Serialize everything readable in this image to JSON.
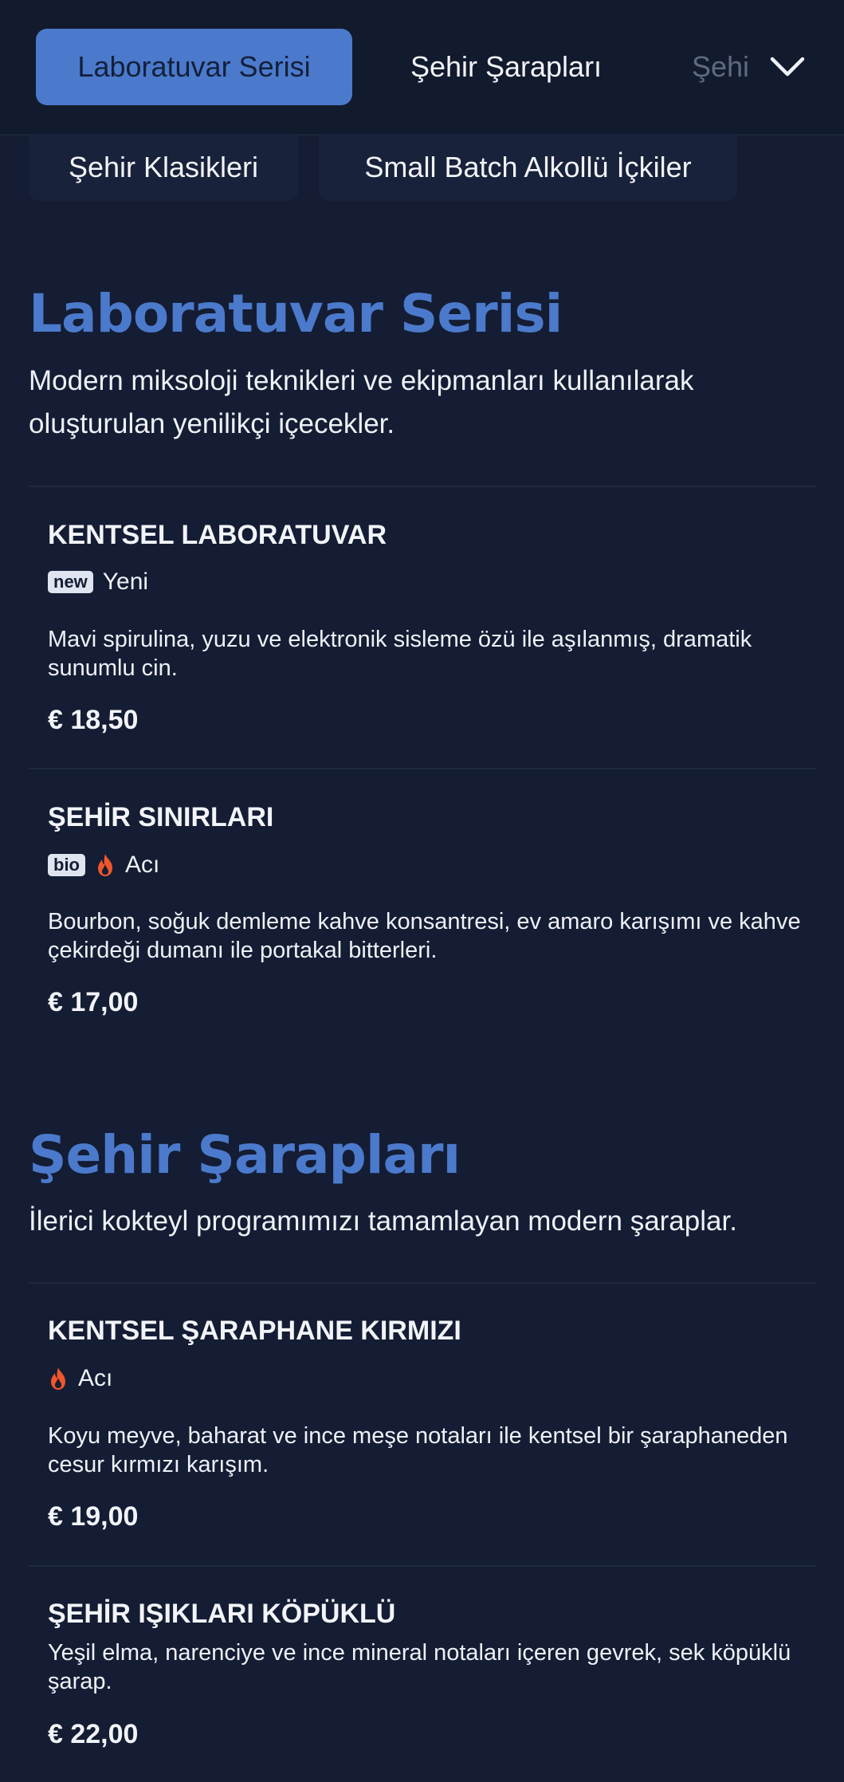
{
  "nav": {
    "tabs": [
      {
        "label": "Laboratuvar Serisi",
        "active": true
      },
      {
        "label": "Şehir Şarapları",
        "active": false
      },
      {
        "label": "Şehir",
        "active": false
      }
    ],
    "subtabs": [
      {
        "label": "Şehir Klasikleri"
      },
      {
        "label": "Small Batch Alkollü İçkiler"
      }
    ],
    "expand_icon": "chevron-down-icon"
  },
  "sections": [
    {
      "title": "Laboratuvar Serisi",
      "description": "Modern miksoloji teknikleri ve ekipmanları kullanılarak oluşturulan yenilikçi içecekler.",
      "items": [
        {
          "name": "KENTSEL LABORATUVAR",
          "badge": "new",
          "tag": "Yeni",
          "description": "Mavi spirulina, yuzu ve elektronik sisleme özü ile aşılanmış, dramatik sunumlu cin.",
          "price": "€ 18,50"
        },
        {
          "name": "ŞEHİR SINIRLARI",
          "badge": "bio",
          "tag": "Acı",
          "tag_icon": "flame-icon",
          "description": "Bourbon, soğuk demleme kahve konsantresi, ev amaro karışımı ve kahve çekirdeği dumanı ile portakal bitterleri.",
          "price": "€ 17,00"
        }
      ]
    },
    {
      "title": "Şehir Şarapları",
      "description": "İlerici kokteyl programımızı tamamlayan modern şaraplar.",
      "items": [
        {
          "name": "KENTSEL ŞARAPHANE KIRMIZI",
          "tag": "Acı",
          "tag_icon": "flame-icon",
          "description": "Koyu meyve, baharat ve ince meşe notaları ile kentsel bir şaraphaneden cesur kırmızı karışım.",
          "price": "€ 19,00"
        },
        {
          "name": "ŞEHİR IŞIKLARI KÖPÜKLÜ",
          "description": "Yeşil elma, narenciye ve ince mineral notaları içeren gevrek, sek köpüklü şarap.",
          "price": "€ 22,00"
        }
      ]
    }
  ],
  "colors": {
    "background": "#141d33",
    "accent": "#4b7acc",
    "text": "#eef1f7",
    "flame": "#f0562b"
  }
}
